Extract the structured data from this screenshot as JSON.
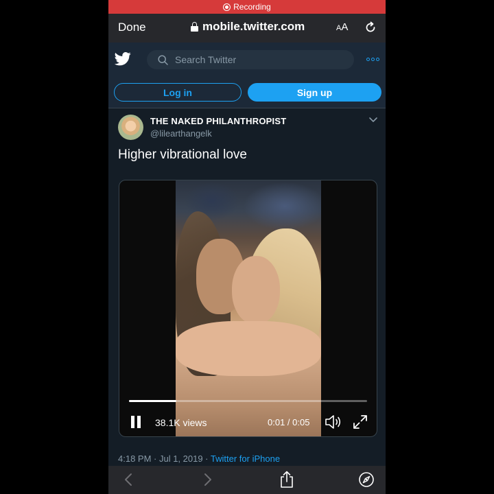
{
  "recording": {
    "label": "Recording"
  },
  "safari": {
    "done_label": "Done",
    "url": "mobile.twitter.com",
    "text_size_big": "A",
    "text_size_small": "A"
  },
  "header": {
    "search_placeholder": "Search Twitter"
  },
  "auth": {
    "login_label": "Log in",
    "signup_label": "Sign up"
  },
  "tweet": {
    "display_name": "THE NAKED PHILANTHROPIST",
    "handle": "@lilearthangelk",
    "text": "Higher vibrational love",
    "video": {
      "views": "38.1K views",
      "time": "0:01 / 0:05",
      "progress": 0.2
    },
    "timestamp": "4:18 PM · Jul 1, 2019 · ",
    "source": "Twitter for iPhone"
  },
  "colors": {
    "accent": "#1da1f2",
    "background": "#141d26",
    "recording": "#d63a3a"
  },
  "icons": [
    "lock-icon",
    "reload-icon",
    "twitter-bird-icon",
    "search-icon",
    "more-icon",
    "chevron-down-icon",
    "pause-icon",
    "volume-icon",
    "fullscreen-icon",
    "back-icon",
    "forward-icon",
    "share-icon",
    "compass-icon"
  ]
}
